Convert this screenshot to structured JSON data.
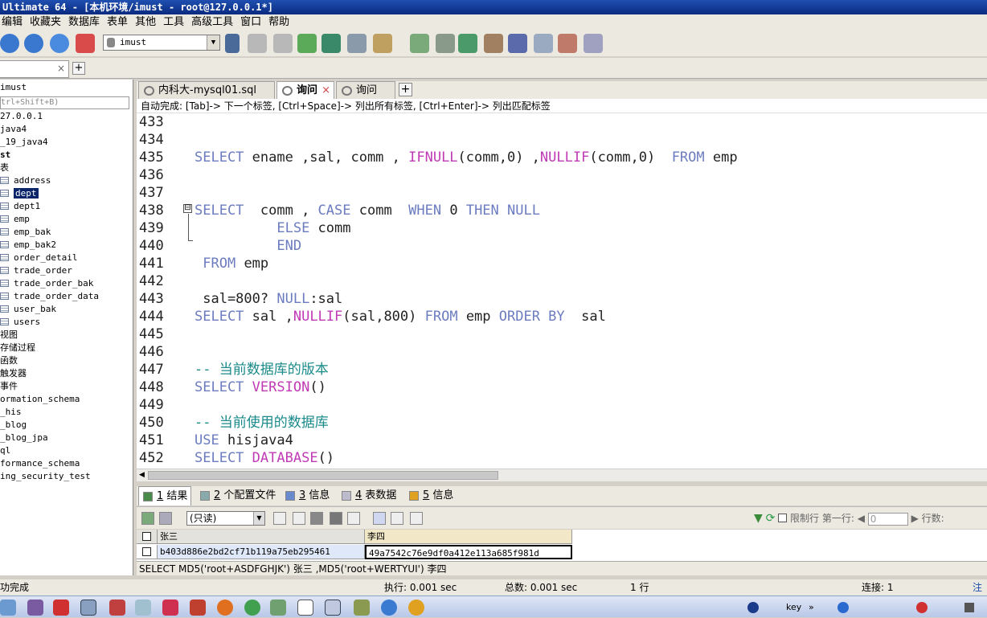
{
  "window": {
    "title": "Ultimate 64 - [本机环境/imust - root@127.0.0.1*]"
  },
  "menu": [
    "编辑",
    "收藏夹",
    "数据库",
    "表单",
    "其他",
    "工具",
    "高级工具",
    "窗口",
    "帮助"
  ],
  "toolbar": {
    "database_select": "imust"
  },
  "connection_tab": {
    "close": "×",
    "add": "+"
  },
  "object_browser": {
    "database": "imust",
    "filter_placeholder": "trl+Shift+B)",
    "items": [
      {
        "label": "27.0.0.1",
        "type": "server"
      },
      {
        "label": "java4",
        "type": "db"
      },
      {
        "label": "_19_java4",
        "type": "db"
      },
      {
        "label": "st",
        "type": "db-open"
      },
      {
        "label": "表",
        "type": "folder"
      },
      {
        "label": "address",
        "type": "table"
      },
      {
        "label": "dept",
        "type": "table",
        "selected": true
      },
      {
        "label": "dept1",
        "type": "table"
      },
      {
        "label": "emp",
        "type": "table"
      },
      {
        "label": "emp_bak",
        "type": "table"
      },
      {
        "label": "emp_bak2",
        "type": "table"
      },
      {
        "label": "order_detail",
        "type": "table"
      },
      {
        "label": "trade_order",
        "type": "table"
      },
      {
        "label": "trade_order_bak",
        "type": "table"
      },
      {
        "label": "trade_order_data",
        "type": "table"
      },
      {
        "label": "user_bak",
        "type": "table"
      },
      {
        "label": "users",
        "type": "table"
      },
      {
        "label": "视图",
        "type": "folder"
      },
      {
        "label": "存储过程",
        "type": "folder"
      },
      {
        "label": "函数",
        "type": "folder"
      },
      {
        "label": "触发器",
        "type": "folder"
      },
      {
        "label": "事件",
        "type": "folder"
      },
      {
        "label": "ormation_schema",
        "type": "db"
      },
      {
        "label": "_his",
        "type": "db"
      },
      {
        "label": "_blog",
        "type": "db"
      },
      {
        "label": "_blog_jpa",
        "type": "db"
      },
      {
        "label": "ql",
        "type": "db"
      },
      {
        "label": "formance_schema",
        "type": "db"
      },
      {
        "label": "ing_security_test",
        "type": "db"
      }
    ]
  },
  "editor_tabs": [
    {
      "label": "内科大-mysql01.sql",
      "active": false
    },
    {
      "label": "询问",
      "active": true,
      "close": "×"
    },
    {
      "label": "询问",
      "active": false
    }
  ],
  "editor_add_tab": "+",
  "autocomplete_hint": "自动完成: [Tab]-> 下一个标签, [Ctrl+Space]-> 列出所有标签, [Ctrl+Enter]-> 列出匹配标签",
  "editor": {
    "fold_marker": "⊟",
    "line_numbers": [
      "433",
      "434",
      "435",
      "436",
      "437",
      "438",
      "439",
      "440",
      "441",
      "442",
      "443",
      "444",
      "445",
      "446",
      "447",
      "448",
      "449",
      "450",
      "451",
      "452"
    ]
  },
  "result_tabs": [
    {
      "num": "1",
      "label": "结果",
      "active": true
    },
    {
      "num": "2",
      "label": "个配置文件",
      "active": false
    },
    {
      "num": "3",
      "label": "信息",
      "active": false
    },
    {
      "num": "4",
      "label": "表数据",
      "active": false
    },
    {
      "num": "5",
      "label": "信息",
      "active": false
    }
  ],
  "result_toolbar": {
    "mode": "(只读)",
    "limit_label": "限制行",
    "first_row_label": "第一行:",
    "first_row_value": "0",
    "rows_label": "行数:"
  },
  "result_grid": {
    "columns": [
      "张三",
      "李四"
    ],
    "rows": [
      [
        "b403d886e2bd2cf71b119a75eb295461",
        "49a7542c76e9df0a412e113a685f981d"
      ]
    ]
  },
  "executed_sql": "SELECT MD5('root+ASDFGHJK') 张三 ,MD5('root+WERTYUI') 李四",
  "status": {
    "left": "功完成",
    "exec": "执行: 0.001 sec",
    "total": "总数: 0.001 sec",
    "rows": "1 行",
    "conn": "连接: 1",
    "reg": "注"
  },
  "tray": {
    "lang": "key",
    "arrows": "»"
  },
  "colors": {
    "keyword": "#6c7cc0",
    "function": "#c03ab5",
    "comment": "#1a8a8a",
    "selection": "#0a246a",
    "titlebar": "#1f4fb0"
  }
}
